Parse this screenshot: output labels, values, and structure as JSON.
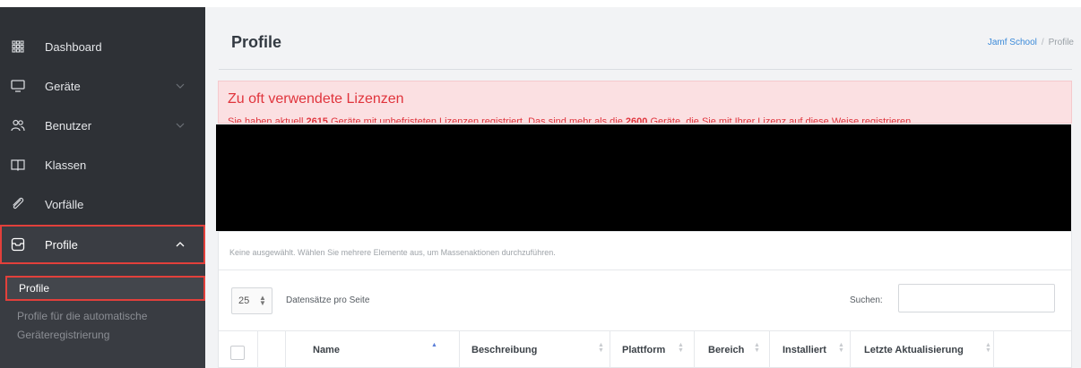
{
  "sidebar": {
    "items": [
      {
        "label": "Dashboard",
        "icon": "grid-icon"
      },
      {
        "label": "Geräte",
        "icon": "monitor-icon"
      },
      {
        "label": "Benutzer",
        "icon": "users-icon"
      },
      {
        "label": "Klassen",
        "icon": "book-icon"
      },
      {
        "label": "Vorfälle",
        "icon": "paperclip-icon"
      },
      {
        "label": "Profile",
        "icon": "profile-box-icon"
      }
    ],
    "sub_items": [
      {
        "label": "Profile"
      },
      {
        "label": "Profile für die automatische Geräteregistrierung"
      }
    ]
  },
  "header": {
    "title": "Profile",
    "breadcrumb": [
      {
        "label": "Jamf School"
      },
      {
        "label": "Profile"
      }
    ],
    "breadcrumb_separator": "/"
  },
  "alert": {
    "title": "Zu oft verwendete Lizenzen",
    "text_part1": "Sie haben aktuell ",
    "count1": "2615",
    "text_part2": " Geräte mit unbefristeten Lizenzen registriert. Das sind mehr als die ",
    "count2": "2600",
    "text_part3": " Geräte, die Sie mit Ihrer Lizenz auf diese Weise registrieren"
  },
  "bulk": {
    "message": "Keine ausgewählt. Wählen Sie mehrere Elemente aus, um Massenaktionen durchzuführen."
  },
  "table_controls": {
    "page_length": "25",
    "page_length_label": "Datensätze pro Seite",
    "search_label": "Suchen:",
    "search_value": ""
  },
  "table": {
    "columns": [
      "Name",
      "Beschreibung",
      "Plattform",
      "Bereich",
      "Installiert",
      "Letzte Aktualisierung"
    ]
  },
  "colors": {
    "sidebar_bg": "#2e3136",
    "highlight": "#e2403b",
    "alert_bg": "#fbe0e2",
    "alert_text": "#e0343c",
    "link": "#3b8ad9"
  }
}
